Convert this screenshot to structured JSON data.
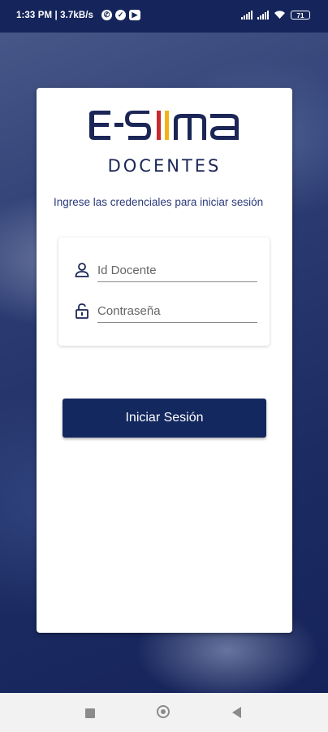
{
  "status_bar": {
    "time_speed": "1:33 PM | 3.7kB/s",
    "icons": [
      "whatsapp-icon",
      "check-icon",
      "youtube-icon"
    ],
    "battery": "71"
  },
  "app": {
    "logo_text": "E-SIIMA",
    "subtitle": "DOCENTES",
    "instructions": "Ingrese las credenciales para iniciar sesión"
  },
  "form": {
    "id_placeholder": "Id Docente",
    "password_placeholder": "Contraseña",
    "login_label": "Iniciar Sesión"
  },
  "colors": {
    "primary": "#13285f",
    "accent_red": "#c8292f",
    "accent_yellow": "#f2b316"
  }
}
